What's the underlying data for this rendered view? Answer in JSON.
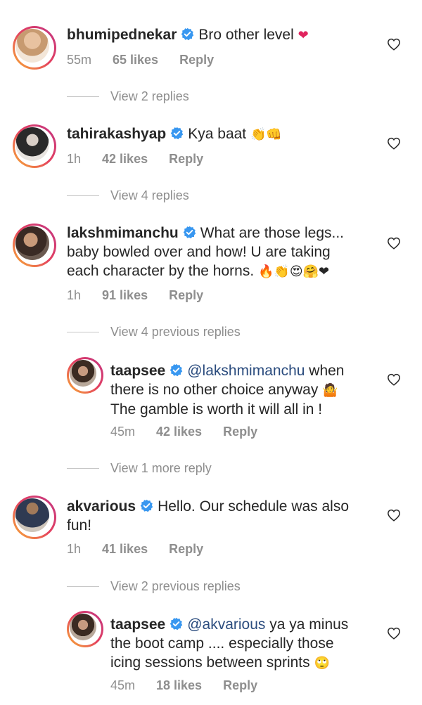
{
  "comments": [
    {
      "username": "bhumipednekar",
      "text": "Bro other level",
      "emoji": "❤",
      "time": "55m",
      "likes": "65 likes",
      "reply": "Reply",
      "view_replies": "View 2 replies"
    },
    {
      "username": "tahirakashyap",
      "text": "Kya baat",
      "emoji": "👏👊",
      "time": "1h",
      "likes": "42 likes",
      "reply": "Reply",
      "view_replies": "View 4 replies"
    },
    {
      "username": "lakshmimanchu",
      "text_line1": "What are those legs...",
      "text_line2": "baby bowled over and how! U are taking",
      "text_line3": "each character by the horns.",
      "emoji": "🔥👏😍🤗❤",
      "time": "1h",
      "likes": "91 likes",
      "reply": "Reply",
      "view_replies": "View 4 previous replies",
      "reply_comment": {
        "username": "taapsee",
        "mention": "@lakshmimanchu",
        "text_line1": "when",
        "text_line2": "there is no other choice anyway",
        "emoji": "🤷",
        "text_line3": "The gamble is worth it will all in !",
        "time": "45m",
        "likes": "42 likes",
        "reply": "Reply"
      },
      "view_more": "View 1 more reply"
    },
    {
      "username": "akvarious",
      "text_line1": "Hello. Our schedule was also",
      "text_line2": "fun!",
      "time": "1h",
      "likes": "41 likes",
      "reply": "Reply",
      "view_replies": "View 2 previous replies",
      "reply_comment": {
        "username": "taapsee",
        "mention": "@akvarious",
        "text_line1": "ya ya minus",
        "text_line2": "the boot camp .... especially those",
        "text_line3": "icing sessions between sprints",
        "emoji": "🙄",
        "time": "45m",
        "likes": "18 likes",
        "reply": "Reply"
      }
    }
  ],
  "colors": {
    "text": "#262626",
    "meta": "#8e8e8e",
    "mention": "#2b4c7e",
    "verified": "#3897f0",
    "ring": "#e4405f"
  }
}
